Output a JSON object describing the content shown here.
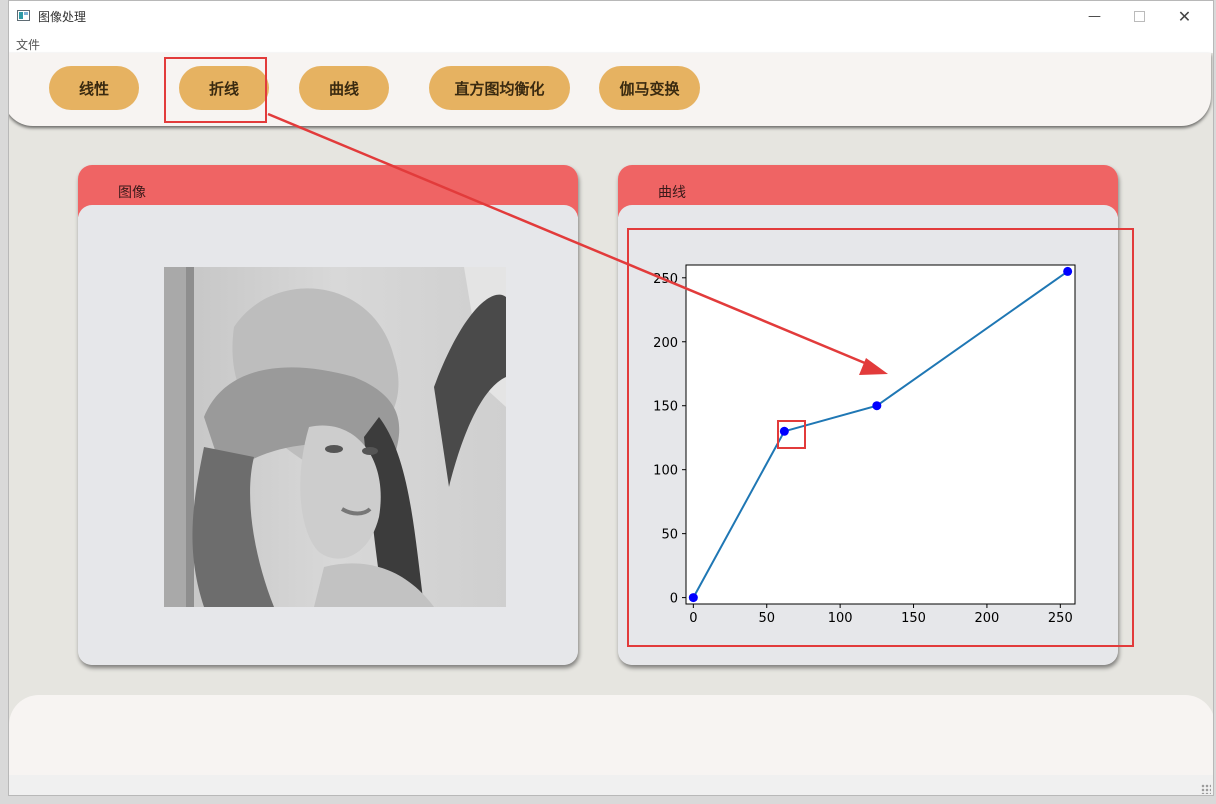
{
  "window": {
    "title": "图像处理"
  },
  "menu": {
    "file_label": "文件"
  },
  "toolbar": {
    "buttons": [
      {
        "label": "线性"
      },
      {
        "label": "折线"
      },
      {
        "label": "曲线"
      },
      {
        "label": "直方图均衡化"
      },
      {
        "label": "伽马变换"
      }
    ]
  },
  "image_panel": {
    "title": "图像"
  },
  "curve_panel": {
    "title": "曲线"
  },
  "chart_data": {
    "type": "line",
    "x": [
      0,
      62,
      125,
      255
    ],
    "y": [
      0,
      130,
      150,
      255
    ],
    "xlim": [
      -5,
      260
    ],
    "ylim": [
      -5,
      260
    ],
    "xticks": [
      0,
      50,
      100,
      150,
      200,
      250
    ],
    "yticks": [
      0,
      50,
      100,
      150,
      200,
      250
    ],
    "line_color": "#1f77b4",
    "marker_color": "#0000ff",
    "grid": false
  },
  "colors": {
    "accent_button": "#e6b261",
    "panel_header": "#ef6464",
    "annotation": "#e23b3b"
  }
}
